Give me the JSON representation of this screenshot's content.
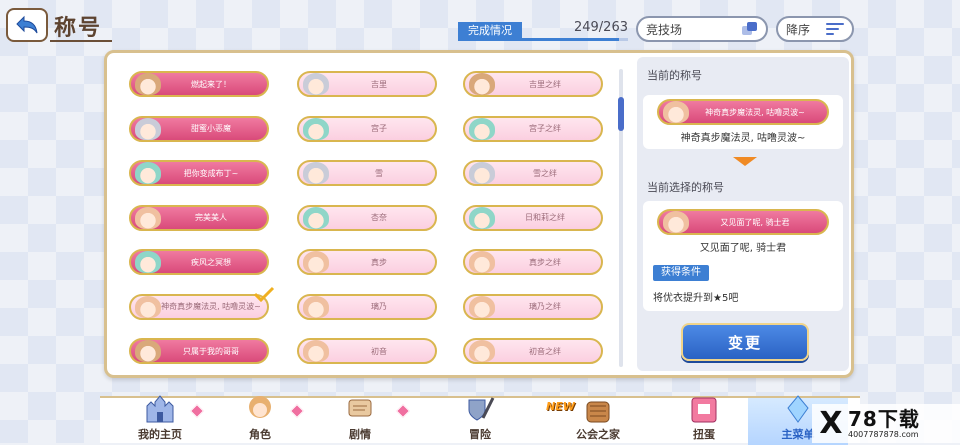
{
  "header": {
    "title": "称号",
    "completion_label": "完成情况",
    "completion_value": "249/263",
    "completion_ratio": 0.9468,
    "filter_value": "竞技场",
    "sort_label": "降序"
  },
  "titles": [
    {
      "label": "燃起来了！",
      "style": "bright",
      "face": "f1",
      "checked": false
    },
    {
      "label": "吉里",
      "style": "pale",
      "face": "f2",
      "checked": false
    },
    {
      "label": "吉里之绊",
      "style": "pale",
      "face": "f1",
      "checked": false
    },
    {
      "label": "甜蜜小恶魔",
      "style": "bright",
      "face": "f2",
      "checked": false
    },
    {
      "label": "宫子",
      "style": "pale",
      "face": "f3",
      "checked": false
    },
    {
      "label": "宫子之绊",
      "style": "pale",
      "face": "f3",
      "checked": false
    },
    {
      "label": "把你变成布丁~",
      "style": "bright",
      "face": "f3",
      "checked": false
    },
    {
      "label": "雪",
      "style": "pale",
      "face": "f2",
      "checked": false
    },
    {
      "label": "雪之绊",
      "style": "pale",
      "face": "f2",
      "checked": false
    },
    {
      "label": "完美美人",
      "style": "bright",
      "face": "f4",
      "checked": false
    },
    {
      "label": "杏奈",
      "style": "pale",
      "face": "f3",
      "checked": false
    },
    {
      "label": "日和莉之绊",
      "style": "pale",
      "face": "f3",
      "checked": false
    },
    {
      "label": "疾风之冥想",
      "style": "bright",
      "face": "f3",
      "checked": false
    },
    {
      "label": "真步",
      "style": "pale",
      "face": "f4",
      "checked": false
    },
    {
      "label": "真步之绊",
      "style": "pale",
      "face": "f4",
      "checked": false
    },
    {
      "label": "神奇真步魔法灵, 咕噜灵波~",
      "style": "pale",
      "face": "f4",
      "checked": true
    },
    {
      "label": "璃乃",
      "style": "pale",
      "face": "f4",
      "checked": false
    },
    {
      "label": "璃乃之绊",
      "style": "pale",
      "face": "f4",
      "checked": false
    },
    {
      "label": "只属于我的哥哥",
      "style": "bright",
      "face": "f1",
      "checked": false
    },
    {
      "label": "初音",
      "style": "pale",
      "face": "f4",
      "checked": false
    },
    {
      "label": "初音之绊",
      "style": "pale",
      "face": "f4",
      "checked": false
    }
  ],
  "info": {
    "current_heading": "当前的称号",
    "current_badge": "神奇真步魔法灵, 咕噜灵波~",
    "current_text": "神奇真步魔法灵, 咕噜灵波~",
    "selected_heading": "当前选择的称号",
    "selected_badge": "又见面了呢, 骑士君",
    "selected_text": "又见面了呢, 骑士君",
    "condition_label": "获得条件",
    "condition_text": "将优衣提升到★5吧",
    "change_button": "变更"
  },
  "nav": {
    "items": [
      {
        "label": "我的主页",
        "icon": "castle-icon"
      },
      {
        "label": "角色",
        "icon": "character-icon"
      },
      {
        "label": "剧情",
        "icon": "scroll-icon"
      },
      {
        "label": "冒险",
        "icon": "sword-shield-icon"
      },
      {
        "label": "公会之家",
        "icon": "guild-house-icon"
      },
      {
        "label": "扭蛋",
        "icon": "gacha-icon"
      },
      {
        "label": "主菜单",
        "icon": "crystal-icon"
      }
    ],
    "new_badge": "NEW"
  },
  "watermark": {
    "brand": "78下载",
    "url": "4007787878.com",
    "x_mark": "X"
  }
}
